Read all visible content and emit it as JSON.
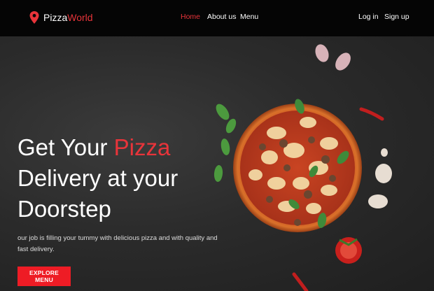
{
  "nav": {
    "brand_prefix": "Pizza",
    "brand_suffix": "World",
    "links": [
      {
        "label": "Home",
        "active": true
      },
      {
        "label": "About us"
      },
      {
        "label": "Menu"
      }
    ],
    "auth": {
      "login": "Log in",
      "signup": "Sign up"
    }
  },
  "hero": {
    "headline_part1": "Get Your",
    "headline_highlight": "Pizza",
    "headline_line2": "Delivery at your",
    "headline_line3": "Doorstep",
    "description": "our job is filling your tummy with delicious pizza and with quality and fast delivery.",
    "cta_label": "EXPLORE MENU"
  },
  "colors": {
    "accent": "#e8343a",
    "button": "#ee1c25",
    "navbar": "#050505"
  }
}
